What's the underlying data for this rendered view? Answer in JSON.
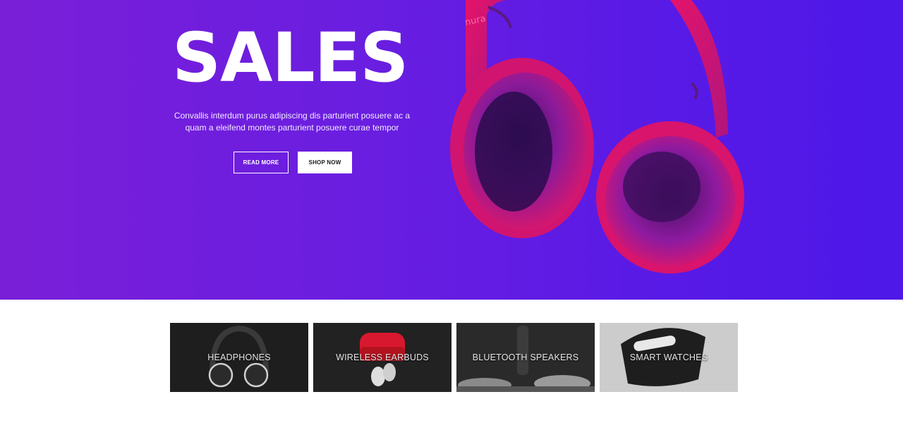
{
  "hero": {
    "title": "SALES",
    "description": "Convallis interdum purus adipiscing dis parturient posuere ac a quam a eleifend montes parturient posuere curae tempor",
    "read_more_label": "READ MORE",
    "shop_now_label": "SHOP NOW",
    "product_image": "headphones-image",
    "brand_mark": "nura",
    "gradient_start": "#7a1fd8",
    "gradient_end": "#4d18e8"
  },
  "categories": [
    {
      "label": "HEADPHONES",
      "image": "headphones-thumb"
    },
    {
      "label": "WIRELESS EARBUDS",
      "image": "earbuds-thumb"
    },
    {
      "label": "BLUETOOTH SPEAKERS",
      "image": "speakers-thumb"
    },
    {
      "label": "SMART WATCHES",
      "image": "smartwatch-thumb"
    }
  ]
}
